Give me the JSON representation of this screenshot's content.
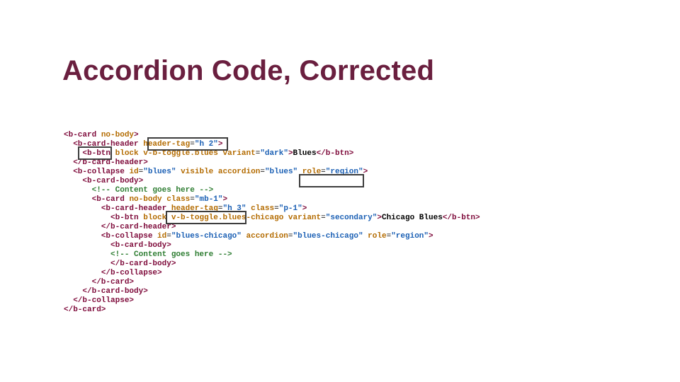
{
  "title": "Accordion Code, Corrected",
  "code": {
    "lines": [
      {
        "indent": 0,
        "tokens": [
          {
            "c": "tag",
            "t": "<b-card"
          },
          {
            "c": "punct",
            "t": " "
          },
          {
            "c": "attr",
            "t": "no-body"
          },
          {
            "c": "tag",
            "t": ">"
          }
        ]
      },
      {
        "indent": 1,
        "tokens": [
          {
            "c": "tag",
            "t": "<b-card-header"
          },
          {
            "c": "punct",
            "t": " "
          },
          {
            "c": "attr",
            "t": "header-tag"
          },
          {
            "c": "punct",
            "t": "="
          },
          {
            "c": "val",
            "t": "\"h 2\""
          },
          {
            "c": "tag",
            "t": ">"
          }
        ]
      },
      {
        "indent": 2,
        "tokens": [
          {
            "c": "tag",
            "t": "<b-btn"
          },
          {
            "c": "punct",
            "t": " "
          },
          {
            "c": "attr",
            "t": "block"
          },
          {
            "c": "punct",
            "t": " "
          },
          {
            "c": "attr",
            "t": "v-b-toggle."
          },
          {
            "c": "attr",
            "t": "blues"
          },
          {
            "c": "punct",
            "t": " "
          },
          {
            "c": "attr",
            "t": "variant"
          },
          {
            "c": "punct",
            "t": "="
          },
          {
            "c": "val",
            "t": "\"dark\""
          },
          {
            "c": "tag",
            "t": ">"
          },
          {
            "c": "text",
            "t": "Blues"
          },
          {
            "c": "tag",
            "t": "</b-btn>"
          }
        ]
      },
      {
        "indent": 1,
        "tokens": [
          {
            "c": "tag",
            "t": "</b-card-header>"
          }
        ]
      },
      {
        "indent": 1,
        "tokens": [
          {
            "c": "tag",
            "t": "<b-collapse"
          },
          {
            "c": "punct",
            "t": " "
          },
          {
            "c": "attr",
            "t": "id"
          },
          {
            "c": "punct",
            "t": "="
          },
          {
            "c": "val",
            "t": "\"blues\""
          },
          {
            "c": "punct",
            "t": " "
          },
          {
            "c": "attr",
            "t": "visible"
          },
          {
            "c": "punct",
            "t": " "
          },
          {
            "c": "attr",
            "t": "accordion"
          },
          {
            "c": "punct",
            "t": "="
          },
          {
            "c": "val",
            "t": "\"blues\""
          },
          {
            "c": "punct",
            "t": " "
          },
          {
            "c": "attr",
            "t": "role"
          },
          {
            "c": "punct",
            "t": "="
          },
          {
            "c": "val",
            "t": "\"region\""
          },
          {
            "c": "tag",
            "t": ">"
          }
        ]
      },
      {
        "indent": 2,
        "tokens": [
          {
            "c": "tag",
            "t": "<b-card-body>"
          }
        ]
      },
      {
        "indent": 3,
        "tokens": [
          {
            "c": "com",
            "t": "<!-- Content goes here -->"
          }
        ]
      },
      {
        "indent": 3,
        "tokens": [
          {
            "c": "tag",
            "t": "<b-card"
          },
          {
            "c": "punct",
            "t": " "
          },
          {
            "c": "attr",
            "t": "no-body"
          },
          {
            "c": "punct",
            "t": " "
          },
          {
            "c": "attr",
            "t": "class"
          },
          {
            "c": "punct",
            "t": "="
          },
          {
            "c": "val",
            "t": "\"mb-1\""
          },
          {
            "c": "tag",
            "t": ">"
          }
        ]
      },
      {
        "indent": 4,
        "tokens": [
          {
            "c": "tag",
            "t": "<b-card-header"
          },
          {
            "c": "punct",
            "t": " "
          },
          {
            "c": "attr",
            "t": "header-tag"
          },
          {
            "c": "punct",
            "t": "="
          },
          {
            "c": "val",
            "t": "\"h 3\""
          },
          {
            "c": "punct",
            "t": " "
          },
          {
            "c": "attr",
            "t": "class"
          },
          {
            "c": "punct",
            "t": "="
          },
          {
            "c": "val",
            "t": "\"p-1\""
          },
          {
            "c": "tag",
            "t": ">"
          }
        ]
      },
      {
        "indent": 5,
        "tokens": [
          {
            "c": "tag",
            "t": "<b-btn"
          },
          {
            "c": "punct",
            "t": " "
          },
          {
            "c": "attr",
            "t": "block"
          },
          {
            "c": "punct",
            "t": " "
          },
          {
            "c": "attr",
            "t": "v-b-toggle."
          },
          {
            "c": "attr",
            "t": "blues-chicago"
          },
          {
            "c": "punct",
            "t": " "
          },
          {
            "c": "attr",
            "t": "variant"
          },
          {
            "c": "punct",
            "t": "="
          },
          {
            "c": "val",
            "t": "\"secondary\""
          },
          {
            "c": "tag",
            "t": ">"
          },
          {
            "c": "text",
            "t": "Chicago Blues"
          },
          {
            "c": "tag",
            "t": "</b-btn>"
          }
        ]
      },
      {
        "indent": 4,
        "tokens": [
          {
            "c": "tag",
            "t": "</b-card-header>"
          }
        ]
      },
      {
        "indent": 4,
        "tokens": [
          {
            "c": "tag",
            "t": "<b-collapse"
          },
          {
            "c": "punct",
            "t": " "
          },
          {
            "c": "attr",
            "t": "id"
          },
          {
            "c": "punct",
            "t": "="
          },
          {
            "c": "val",
            "t": "\"blues-chicago\""
          },
          {
            "c": "punct",
            "t": " "
          },
          {
            "c": "attr",
            "t": "accordion"
          },
          {
            "c": "punct",
            "t": "="
          },
          {
            "c": "val",
            "t": "\"blues-chicago\""
          },
          {
            "c": "punct",
            "t": " "
          },
          {
            "c": "attr",
            "t": "role"
          },
          {
            "c": "punct",
            "t": "="
          },
          {
            "c": "val",
            "t": "\"region\""
          },
          {
            "c": "tag",
            "t": ">"
          }
        ]
      },
      {
        "indent": 5,
        "tokens": [
          {
            "c": "tag",
            "t": "<b-card-body>"
          }
        ]
      },
      {
        "indent": 5,
        "tokens": [
          {
            "c": "com",
            "t": "<!-- Content goes here -->"
          }
        ]
      },
      {
        "indent": 5,
        "tokens": [
          {
            "c": "tag",
            "t": "</b-card-body>"
          }
        ]
      },
      {
        "indent": 4,
        "tokens": [
          {
            "c": "tag",
            "t": "</b-collapse>"
          }
        ]
      },
      {
        "indent": 3,
        "tokens": [
          {
            "c": "tag",
            "t": "</b-card>"
          }
        ]
      },
      {
        "indent": 2,
        "tokens": [
          {
            "c": "tag",
            "t": "</b-card-body>"
          }
        ]
      },
      {
        "indent": 1,
        "tokens": [
          {
            "c": "tag",
            "t": "</b-collapse>"
          }
        ]
      },
      {
        "indent": 0,
        "tokens": [
          {
            "c": "tag",
            "t": "</b-card>"
          }
        ]
      }
    ]
  },
  "highlight_boxes": [
    {
      "label": "header-tag=\"h 2\""
    },
    {
      "label": "<b-btn"
    },
    {
      "label": "role=\"region\""
    },
    {
      "label": "header-tag=\"h 3\""
    }
  ]
}
